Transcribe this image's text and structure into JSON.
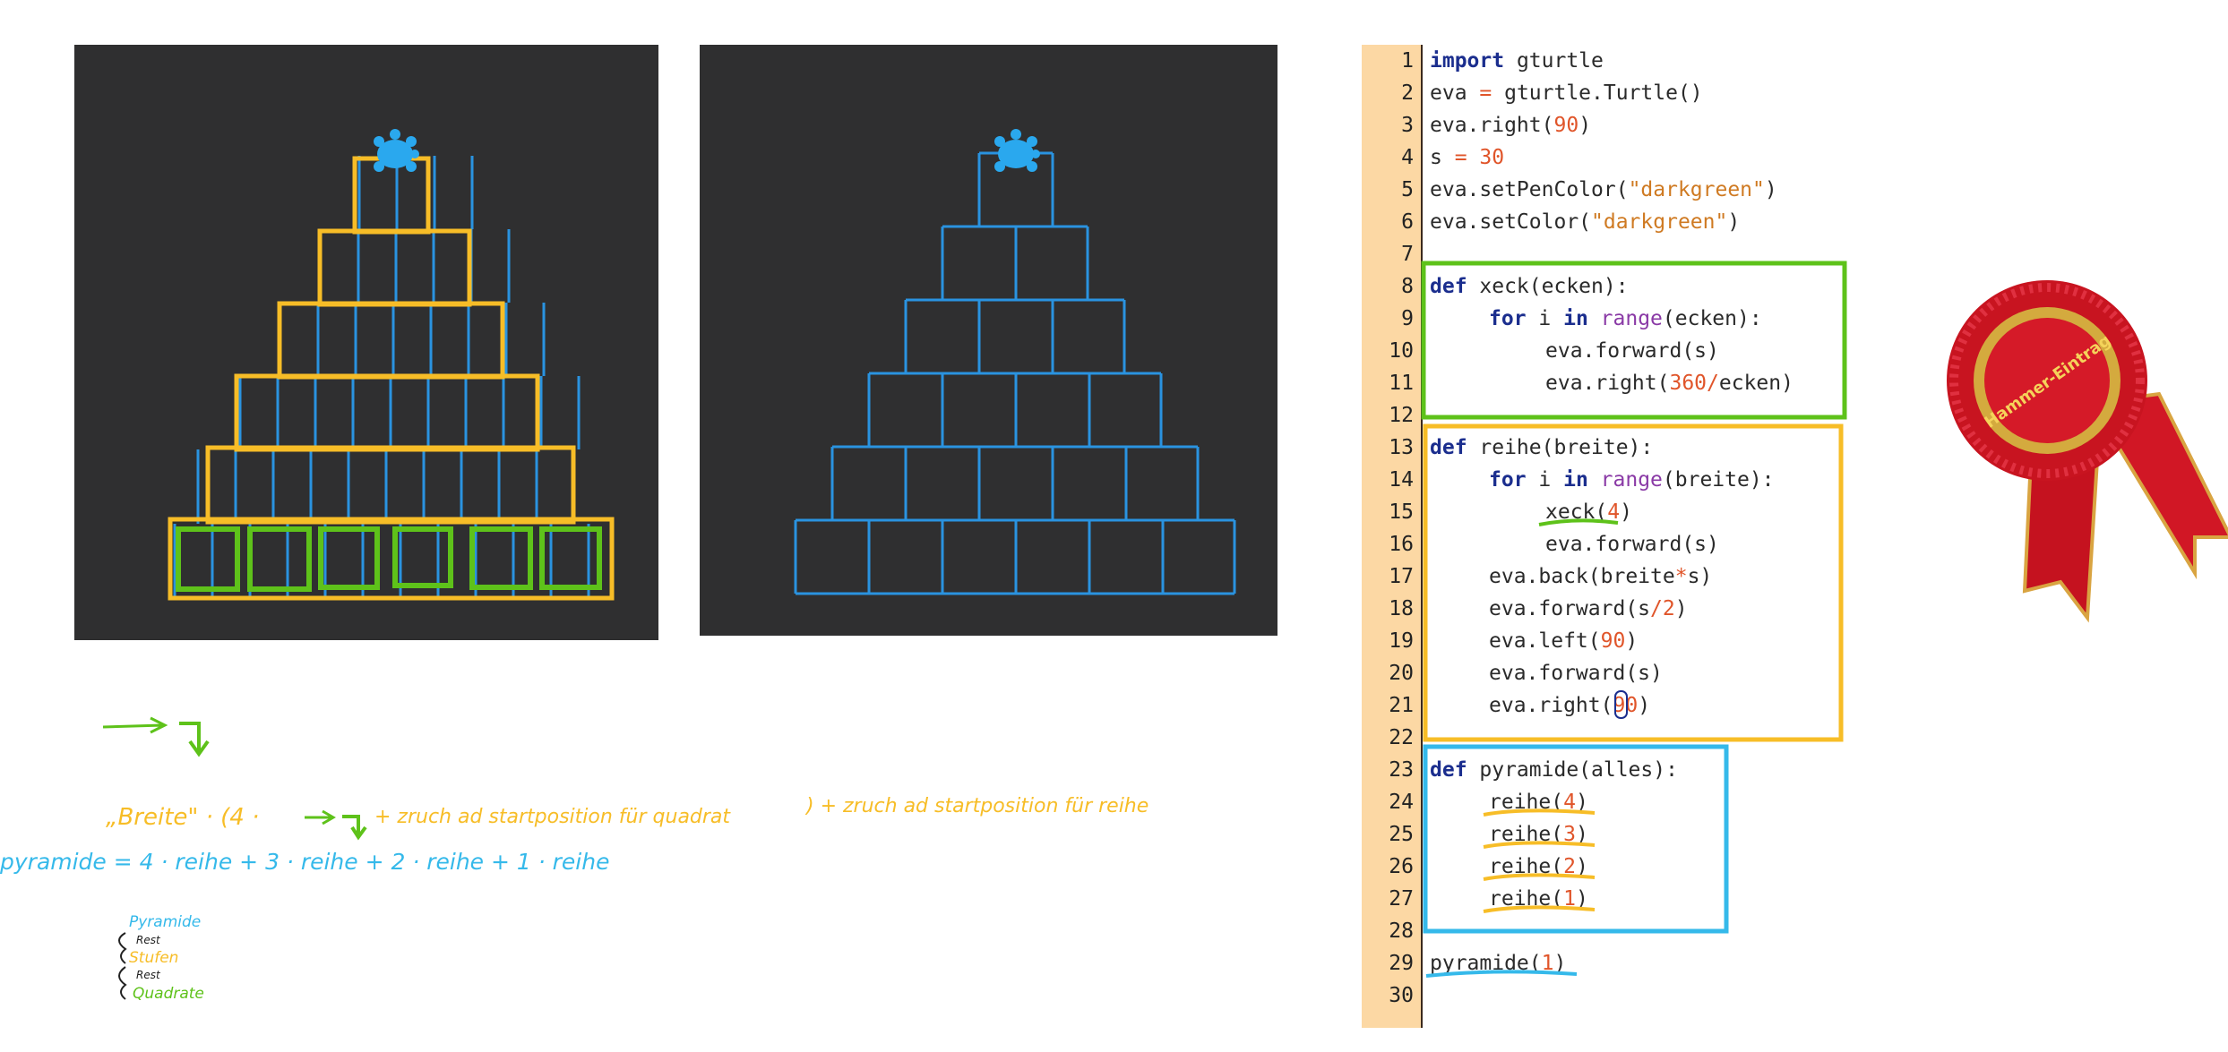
{
  "code": {
    "line_numbers": [
      "1",
      "2",
      "3",
      "4",
      "5",
      "6",
      "7",
      "8",
      "9",
      "10",
      "11",
      "12",
      "13",
      "14",
      "15",
      "16",
      "17",
      "18",
      "19",
      "20",
      "21",
      "22",
      "23",
      "24",
      "25",
      "26",
      "27",
      "28",
      "29",
      "30"
    ],
    "l1": {
      "kw": "import",
      "rest": " gturtle"
    },
    "l2": {
      "a": "eva ",
      "op": "=",
      "b": " gturtle.Turtle()"
    },
    "l3": {
      "a": "eva.right(",
      "n": "90",
      "b": ")"
    },
    "l4": {
      "a": "s ",
      "op": "=",
      "b": " ",
      "n": "30"
    },
    "l5": {
      "a": "eva.setPenColor(",
      "s": "\"darkgreen\"",
      "b": ")"
    },
    "l6": {
      "a": "eva.setColor(",
      "s": "\"darkgreen\"",
      "b": ")"
    },
    "l8": {
      "kw": "def",
      "rest": " xeck(ecken):"
    },
    "l9": {
      "kw1": "for",
      "m": " i ",
      "kw2": "in",
      "sp": " ",
      "bi": "range",
      "rest": "(ecken):"
    },
    "l10": "eva.forward(s)",
    "l11": {
      "a": "eva.right(",
      "n": "360",
      "op": "/",
      "b": "ecken)"
    },
    "l13": {
      "kw": "def",
      "rest": " reihe(breite):"
    },
    "l14": {
      "kw1": "for",
      "m": " i ",
      "kw2": "in",
      "sp": " ",
      "bi": "range",
      "rest": "(breite):"
    },
    "l15": {
      "a": "xeck(",
      "n": "4",
      "b": ")"
    },
    "l16": "eva.forward(s)",
    "l17": {
      "a": "eva.back(breite",
      "op": "*",
      "b": "s)"
    },
    "l18": {
      "a": "eva.forward(s",
      "op": "/",
      "n": "2",
      "b": ")"
    },
    "l19": {
      "a": "eva.left(",
      "n": "90",
      "b": ")"
    },
    "l20": "eva.forward(s)",
    "l21": {
      "a": "eva.right(",
      "n": "90",
      "b": ")"
    },
    "l23": {
      "kw": "def",
      "rest": " pyramide(alles):"
    },
    "l24": {
      "a": "reihe(",
      "n": "4",
      "b": ")"
    },
    "l25": {
      "a": "reihe(",
      "n": "3",
      "b": ")"
    },
    "l26": {
      "a": "reihe(",
      "n": "2",
      "b": ")"
    },
    "l27": {
      "a": "reihe(",
      "n": "1",
      "b": ")"
    },
    "l29": {
      "a": "pyramide(",
      "n": "1",
      "b": ")"
    }
  },
  "notes": {
    "line1_a": "„Breite\" · (4 ·",
    "line1_b": "+ zruch ad startposition für quadrat",
    "line1_c": ") + zruch ad startposition für reihe",
    "line2_a": "pyramide = 4 · reihe + 3 · reihe + 2 · reihe + 1 · reihe",
    "legend_pyramide": "Pyramide",
    "legend_rest1": "Rest",
    "legend_stufen": "Stufen",
    "legend_rest2": "Rest",
    "legend_quadrate": "Quadrate"
  },
  "ribbon": {
    "label": "Hammer-Eintrag"
  },
  "colors": {
    "green": "#5ec21a",
    "orange": "#f7bd27",
    "blue": "#35b9ea",
    "turtle_blue": "#2a93e0",
    "panel": "#2f2f30"
  }
}
